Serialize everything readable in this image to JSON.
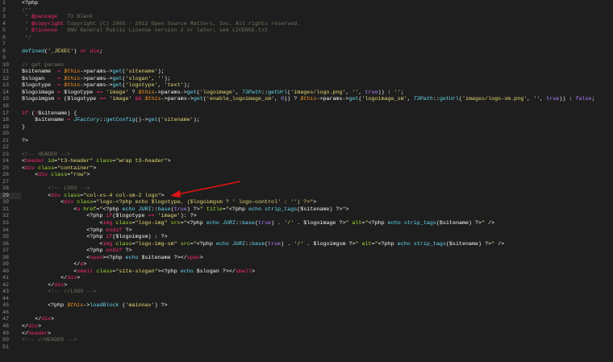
{
  "code": {
    "current_line": 29,
    "lines": [
      [
        [
          "p",
          "<?php"
        ]
      ],
      [
        [
          "c",
          "/**"
        ]
      ],
      [
        [
          "c",
          " * "
        ],
        [
          "k",
          "@package"
        ],
        [
          "c",
          "   T3 Blank"
        ]
      ],
      [
        [
          "c",
          " * "
        ],
        [
          "k",
          "@copyright"
        ],
        [
          "c",
          " Copyright (C) 2005 - 2012 Open Source Matters, Inc. All rights reserved."
        ]
      ],
      [
        [
          "c",
          " * "
        ],
        [
          "k",
          "@license"
        ],
        [
          "c",
          "   GNU General Public License version 2 or later; see LICENSE.txt"
        ]
      ],
      [
        [
          "c",
          " */"
        ]
      ],
      [],
      [
        [
          "f",
          "defined"
        ],
        [
          "p",
          "("
        ],
        [
          "s",
          "'_JEXEC'"
        ],
        [
          "p",
          ") "
        ],
        [
          "k",
          "or"
        ],
        [
          "p",
          " "
        ],
        [
          "k",
          "die"
        ],
        [
          "p",
          ";"
        ]
      ],
      [],
      [
        [
          "c",
          "// get params"
        ]
      ],
      [
        [
          "p",
          "$sitename  "
        ],
        [
          "k",
          "="
        ],
        [
          "p",
          " "
        ],
        [
          "v",
          "$this"
        ],
        [
          "p",
          "->params->"
        ],
        [
          "f",
          "get"
        ],
        [
          "p",
          "("
        ],
        [
          "s",
          "'sitename'"
        ],
        [
          "p",
          ");"
        ]
      ],
      [
        [
          "p",
          "$slogan    "
        ],
        [
          "k",
          "="
        ],
        [
          "p",
          " "
        ],
        [
          "v",
          "$this"
        ],
        [
          "p",
          "->params->"
        ],
        [
          "f",
          "get"
        ],
        [
          "p",
          "("
        ],
        [
          "s",
          "'slogan'"
        ],
        [
          "p",
          ", "
        ],
        [
          "s",
          "''"
        ],
        [
          "p",
          ");"
        ]
      ],
      [
        [
          "p",
          "$logotype  "
        ],
        [
          "k",
          "="
        ],
        [
          "p",
          " "
        ],
        [
          "v",
          "$this"
        ],
        [
          "p",
          "->params->"
        ],
        [
          "f",
          "get"
        ],
        [
          "p",
          "("
        ],
        [
          "s",
          "'logotype'"
        ],
        [
          "p",
          ", "
        ],
        [
          "s",
          "'text'"
        ],
        [
          "p",
          ");"
        ]
      ],
      [
        [
          "p",
          "$logoimage "
        ],
        [
          "k",
          "="
        ],
        [
          "p",
          " $logotype "
        ],
        [
          "k",
          "=="
        ],
        [
          "p",
          " "
        ],
        [
          "s",
          "'image'"
        ],
        [
          "p",
          " ? "
        ],
        [
          "v",
          "$this"
        ],
        [
          "p",
          "->params->"
        ],
        [
          "f",
          "get"
        ],
        [
          "p",
          "("
        ],
        [
          "s",
          "'logoimage'"
        ],
        [
          "p",
          ", "
        ],
        [
          "i",
          "T3Path"
        ],
        [
          "p",
          "::"
        ],
        [
          "f",
          "getUrl"
        ],
        [
          "p",
          "("
        ],
        [
          "s",
          "'images/logo.png'"
        ],
        [
          "p",
          ", "
        ],
        [
          "s",
          "''"
        ],
        [
          "p",
          ", "
        ],
        [
          "n",
          "true"
        ],
        [
          "p",
          ")) : "
        ],
        [
          "s",
          "''"
        ],
        [
          "p",
          ";"
        ]
      ],
      [
        [
          "p",
          "$logoimgsm "
        ],
        [
          "k",
          "="
        ],
        [
          "p",
          " ($logotype "
        ],
        [
          "k",
          "=="
        ],
        [
          "p",
          " "
        ],
        [
          "s",
          "'image'"
        ],
        [
          "p",
          " "
        ],
        [
          "k",
          "&&"
        ],
        [
          "p",
          " "
        ],
        [
          "v",
          "$this"
        ],
        [
          "p",
          "->params->"
        ],
        [
          "f",
          "get"
        ],
        [
          "p",
          "("
        ],
        [
          "s",
          "'enable_logoimage_sm'"
        ],
        [
          "p",
          ", "
        ],
        [
          "n",
          "0"
        ],
        [
          "p",
          ")) ? "
        ],
        [
          "v",
          "$this"
        ],
        [
          "p",
          "->params->"
        ],
        [
          "f",
          "get"
        ],
        [
          "p",
          "("
        ],
        [
          "s",
          "'logoimage_sm'"
        ],
        [
          "p",
          ", "
        ],
        [
          "i",
          "T3Path"
        ],
        [
          "p",
          "::"
        ],
        [
          "f",
          "getUrl"
        ],
        [
          "p",
          "("
        ],
        [
          "s",
          "'images/logo-sm.png'"
        ],
        [
          "p",
          ", "
        ],
        [
          "s",
          "''"
        ],
        [
          "p",
          ", "
        ],
        [
          "n",
          "true"
        ],
        [
          "p",
          ")) : "
        ],
        [
          "n",
          "false"
        ],
        [
          "p",
          ";"
        ]
      ],
      [],
      [
        [
          "k",
          "if"
        ],
        [
          "p",
          " ("
        ],
        [
          "k",
          "!"
        ],
        [
          "p",
          "$sitename) {"
        ]
      ],
      [
        [
          "p",
          "\t$sitename "
        ],
        [
          "k",
          "="
        ],
        [
          "p",
          " "
        ],
        [
          "i",
          "JFactory"
        ],
        [
          "p",
          "::"
        ],
        [
          "f",
          "getConfig"
        ],
        [
          "p",
          "()->"
        ],
        [
          "f",
          "get"
        ],
        [
          "p",
          "("
        ],
        [
          "s",
          "'sitename'"
        ],
        [
          "p",
          ");"
        ]
      ],
      [
        [
          "p",
          "}"
        ]
      ],
      [],
      [
        [
          "p",
          "?>"
        ]
      ],
      [],
      [
        [
          "c",
          "<!-- HEADER -->"
        ]
      ],
      [
        [
          "p",
          "<"
        ],
        [
          "t",
          "header"
        ],
        [
          "p",
          " "
        ],
        [
          "a",
          "id"
        ],
        [
          "p",
          "="
        ],
        [
          "s",
          "\"t3-header\""
        ],
        [
          "p",
          " "
        ],
        [
          "a",
          "class"
        ],
        [
          "p",
          "="
        ],
        [
          "s",
          "\"wrap t3-header\""
        ],
        [
          "p",
          ">"
        ]
      ],
      [
        [
          "p",
          "<"
        ],
        [
          "t",
          "div"
        ],
        [
          "p",
          " "
        ],
        [
          "a",
          "class"
        ],
        [
          "p",
          "="
        ],
        [
          "s",
          "\"container\""
        ],
        [
          "p",
          ">"
        ]
      ],
      [
        [
          "p",
          "\t<"
        ],
        [
          "t",
          "div"
        ],
        [
          "p",
          " "
        ],
        [
          "a",
          "class"
        ],
        [
          "p",
          "="
        ],
        [
          "s",
          "\"row\""
        ],
        [
          "p",
          ">"
        ]
      ],
      [],
      [
        [
          "c",
          "\t\t<!-- LOGO -->"
        ]
      ],
      [
        [
          "p",
          "\t\t<"
        ],
        [
          "t",
          "div"
        ],
        [
          "p",
          " "
        ],
        [
          "a",
          "class"
        ],
        [
          "p",
          "="
        ],
        [
          "s",
          "\"col-xs-4 col-sm-2 logo\""
        ],
        [
          "p",
          ">"
        ]
      ],
      [
        [
          "p",
          "\t\t\t<"
        ],
        [
          "t",
          "div"
        ],
        [
          "p",
          " "
        ],
        [
          "a",
          "class"
        ],
        [
          "p",
          "="
        ],
        [
          "s",
          "\"logo-<?php echo $logotype, ($logoimgsm ? ' logo-control' : '') ?>\""
        ],
        [
          "p",
          ">"
        ]
      ],
      [
        [
          "p",
          "\t\t\t\t<"
        ],
        [
          "t",
          "a"
        ],
        [
          "p",
          " "
        ],
        [
          "a",
          "href"
        ],
        [
          "p",
          "="
        ],
        [
          "s",
          "\""
        ],
        [
          "p",
          "<?php "
        ],
        [
          "f",
          "echo"
        ],
        [
          "p",
          " "
        ],
        [
          "i",
          "JURI"
        ],
        [
          "p",
          "::"
        ],
        [
          "f",
          "base"
        ],
        [
          "p",
          "("
        ],
        [
          "n",
          "true"
        ],
        [
          "p",
          ") ?>"
        ],
        [
          "s",
          "\""
        ],
        [
          "p",
          " "
        ],
        [
          "a",
          "title"
        ],
        [
          "p",
          "="
        ],
        [
          "s",
          "\""
        ],
        [
          "p",
          "<?php "
        ],
        [
          "f",
          "echo strip_tags"
        ],
        [
          "p",
          "($sitename) ?>"
        ],
        [
          "s",
          "\""
        ],
        [
          "p",
          ">"
        ]
      ],
      [
        [
          "p",
          "\t\t\t\t\t<?php "
        ],
        [
          "k",
          "if"
        ],
        [
          "p",
          "($logotype "
        ],
        [
          "k",
          "=="
        ],
        [
          "p",
          " "
        ],
        [
          "s",
          "'image'"
        ],
        [
          "p",
          "): ?>"
        ]
      ],
      [
        [
          "p",
          "\t\t\t\t\t\t<"
        ],
        [
          "t",
          "img"
        ],
        [
          "p",
          " "
        ],
        [
          "a",
          "class"
        ],
        [
          "p",
          "="
        ],
        [
          "s",
          "\"logo-img\""
        ],
        [
          "p",
          " "
        ],
        [
          "a",
          "src"
        ],
        [
          "p",
          "="
        ],
        [
          "s",
          "\""
        ],
        [
          "p",
          "<?php "
        ],
        [
          "f",
          "echo"
        ],
        [
          "p",
          " "
        ],
        [
          "i",
          "JURI"
        ],
        [
          "p",
          "::"
        ],
        [
          "f",
          "base"
        ],
        [
          "p",
          "("
        ],
        [
          "n",
          "true"
        ],
        [
          "p",
          ") . "
        ],
        [
          "s",
          "'/'"
        ],
        [
          "p",
          " . $logoimage ?>"
        ],
        [
          "s",
          "\""
        ],
        [
          "p",
          " "
        ],
        [
          "a",
          "alt"
        ],
        [
          "p",
          "="
        ],
        [
          "s",
          "\""
        ],
        [
          "p",
          "<?php "
        ],
        [
          "f",
          "echo strip_tags"
        ],
        [
          "p",
          "($sitename) ?>"
        ],
        [
          "s",
          "\""
        ],
        [
          "p",
          " />"
        ]
      ],
      [
        [
          "p",
          "\t\t\t\t\t<?php "
        ],
        [
          "k",
          "endif"
        ],
        [
          "p",
          " ?>"
        ]
      ],
      [
        [
          "p",
          "\t\t\t\t\t<?php "
        ],
        [
          "k",
          "if"
        ],
        [
          "p",
          "($logoimgsm) : ?>"
        ]
      ],
      [
        [
          "p",
          "\t\t\t\t\t\t<"
        ],
        [
          "t",
          "img"
        ],
        [
          "p",
          " "
        ],
        [
          "a",
          "class"
        ],
        [
          "p",
          "="
        ],
        [
          "s",
          "\"logo-img-sm\""
        ],
        [
          "p",
          " "
        ],
        [
          "a",
          "src"
        ],
        [
          "p",
          "="
        ],
        [
          "s",
          "\""
        ],
        [
          "p",
          "<?php "
        ],
        [
          "f",
          "echo"
        ],
        [
          "p",
          " "
        ],
        [
          "i",
          "JURI"
        ],
        [
          "p",
          "::"
        ],
        [
          "f",
          "base"
        ],
        [
          "p",
          "("
        ],
        [
          "n",
          "true"
        ],
        [
          "p",
          ") . "
        ],
        [
          "s",
          "'/'"
        ],
        [
          "p",
          " . $logoimgsm ?>"
        ],
        [
          "s",
          "\""
        ],
        [
          "p",
          " "
        ],
        [
          "a",
          "alt"
        ],
        [
          "p",
          "="
        ],
        [
          "s",
          "\""
        ],
        [
          "p",
          "<?php "
        ],
        [
          "f",
          "echo strip_tags"
        ],
        [
          "p",
          "($sitename) ?>"
        ],
        [
          "s",
          "\""
        ],
        [
          "p",
          " />"
        ]
      ],
      [
        [
          "p",
          "\t\t\t\t\t<?php "
        ],
        [
          "k",
          "endif"
        ],
        [
          "p",
          " ?>"
        ]
      ],
      [
        [
          "p",
          "\t\t\t\t\t<"
        ],
        [
          "t",
          "span"
        ],
        [
          "p",
          "><?php "
        ],
        [
          "f",
          "echo"
        ],
        [
          "p",
          " $sitename ?></"
        ],
        [
          "t",
          "span"
        ],
        [
          "p",
          ">"
        ]
      ],
      [
        [
          "p",
          "\t\t\t\t</"
        ],
        [
          "t",
          "a"
        ],
        [
          "p",
          ">"
        ]
      ],
      [
        [
          "p",
          "\t\t\t\t<"
        ],
        [
          "t",
          "small"
        ],
        [
          "p",
          " "
        ],
        [
          "a",
          "class"
        ],
        [
          "p",
          "="
        ],
        [
          "s",
          "\"site-slogan\""
        ],
        [
          "p",
          "><?php "
        ],
        [
          "f",
          "echo"
        ],
        [
          "p",
          " $slogan ?></"
        ],
        [
          "t",
          "small"
        ],
        [
          "p",
          ">"
        ]
      ],
      [
        [
          "p",
          "\t\t\t</"
        ],
        [
          "t",
          "div"
        ],
        [
          "p",
          ">"
        ]
      ],
      [
        [
          "p",
          "\t\t</"
        ],
        [
          "t",
          "div"
        ],
        [
          "p",
          ">"
        ]
      ],
      [
        [
          "c",
          "\t\t<!-- //LOGO -->"
        ]
      ],
      [],
      [
        [
          "p",
          "\t\t<?php "
        ],
        [
          "v",
          "$this"
        ],
        [
          "p",
          "->"
        ],
        [
          "f",
          "loadBlock"
        ],
        [
          "p",
          " ("
        ],
        [
          "s",
          "'mainnav'"
        ],
        [
          "p",
          ") ?>"
        ]
      ],
      [],
      [
        [
          "p",
          "\t</"
        ],
        [
          "t",
          "div"
        ],
        [
          "p",
          ">"
        ]
      ],
      [
        [
          "p",
          "</"
        ],
        [
          "t",
          "div"
        ],
        [
          "p",
          ">"
        ]
      ],
      [
        [
          "p",
          "</"
        ],
        [
          "t",
          "header"
        ],
        [
          "p",
          ">"
        ]
      ],
      [
        [
          "c",
          "<!-- //HEADER -->"
        ]
      ],
      []
    ]
  },
  "annotation": {
    "color": "#e01515"
  }
}
